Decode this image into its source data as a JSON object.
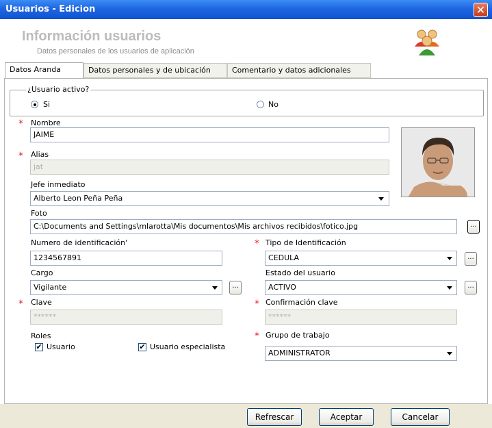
{
  "window": {
    "title": "Usuarios - Edicion",
    "close_glyph": "✕"
  },
  "header": {
    "title": "Información usuarios",
    "subtitle": "Datos personales de los usuarios de aplicación",
    "icon": "users-group-icon"
  },
  "tabs": [
    {
      "label": "Datos Aranda",
      "active": true
    },
    {
      "label": "Datos personales y de ubicación",
      "active": false
    },
    {
      "label": "Comentario y datos adicionales",
      "active": false
    }
  ],
  "active_group": {
    "legend": "¿Usuario activo?",
    "yes_label": "Si",
    "no_label": "No",
    "selected": "Si"
  },
  "required_marker": "*",
  "fields": {
    "nombre": {
      "label": "Nombre",
      "value": "JAIME"
    },
    "alias": {
      "label": "Alias",
      "value": "jat"
    },
    "jefe": {
      "label": "Jefe inmediato",
      "value": "Alberto Leon Peña Peña"
    },
    "foto": {
      "label": "Foto",
      "value": "C:\\Documents and Settings\\mlarotta\\Mis documentos\\Mis archivos recibidos\\fotico.jpg"
    },
    "numero_id": {
      "label": "Numero de identificación'",
      "value": "1234567891"
    },
    "tipo_id": {
      "label": "Tipo de Identificación",
      "value": "CEDULA"
    },
    "cargo": {
      "label": "Cargo",
      "value": "Vigilante"
    },
    "estado": {
      "label": "Estado del usuario",
      "value": "ACTIVO"
    },
    "clave": {
      "label": "Clave",
      "value": "******"
    },
    "confirmacion": {
      "label": "Confirmación clave",
      "value": "******"
    },
    "roles": {
      "label": "Roles",
      "usuario": "Usuario",
      "especialista": "Usuario especialista"
    },
    "grupo": {
      "label": "Grupo de trabajo",
      "value": "ADMINISTRATOR"
    }
  },
  "browse_label": "...",
  "check_glyph": "✔",
  "buttons": {
    "refresh": "Refrescar",
    "accept": "Aceptar",
    "cancel": "Cancelar"
  },
  "colors": {
    "titlebar": "#1f66e0",
    "required": "#d81e1e",
    "footer": "#ece9d8"
  }
}
